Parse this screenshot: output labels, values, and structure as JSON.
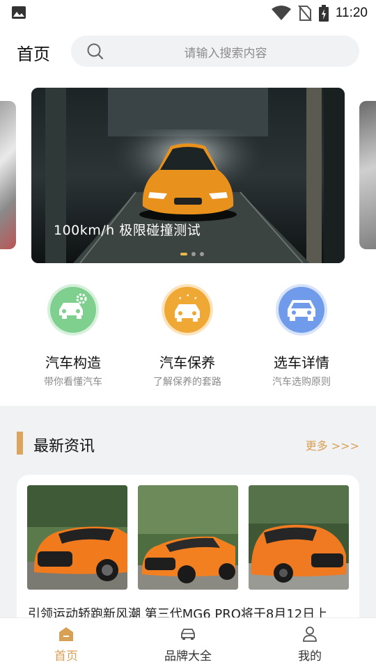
{
  "status_bar": {
    "time": "11:20"
  },
  "header": {
    "title": "首页"
  },
  "search": {
    "placeholder": "请输入搜索内容"
  },
  "banner": {
    "caption": "100km/h 极限碰撞测试",
    "slide_count": 3,
    "active_slide": 0
  },
  "quick_entries": [
    {
      "title": "汽车构造",
      "subtitle": "带你看懂汽车",
      "color": "#7fcf8f",
      "icon": "car-gear-icon"
    },
    {
      "title": "汽车保养",
      "subtitle": "了解保养的套路",
      "color": "#f0a835",
      "icon": "car-wash-icon"
    },
    {
      "title": "选车详情",
      "subtitle": "汽车选购原则",
      "color": "#6f9bea",
      "icon": "car-icon"
    }
  ],
  "news": {
    "section_title": "最新资讯",
    "more_label": "更多 >>>",
    "items": [
      {
        "title": "引领运动轿跑新风潮 第三代MG6 PRO将于8月12日上"
      }
    ]
  },
  "bottom_nav": [
    {
      "label": "首页",
      "icon": "home-icon",
      "active": true
    },
    {
      "label": "品牌大全",
      "icon": "car-front-icon",
      "active": false
    },
    {
      "label": "我的",
      "icon": "person-icon",
      "active": false
    }
  ],
  "colors": {
    "accent": "#d7a055",
    "background_section": "#f1f2f4"
  }
}
